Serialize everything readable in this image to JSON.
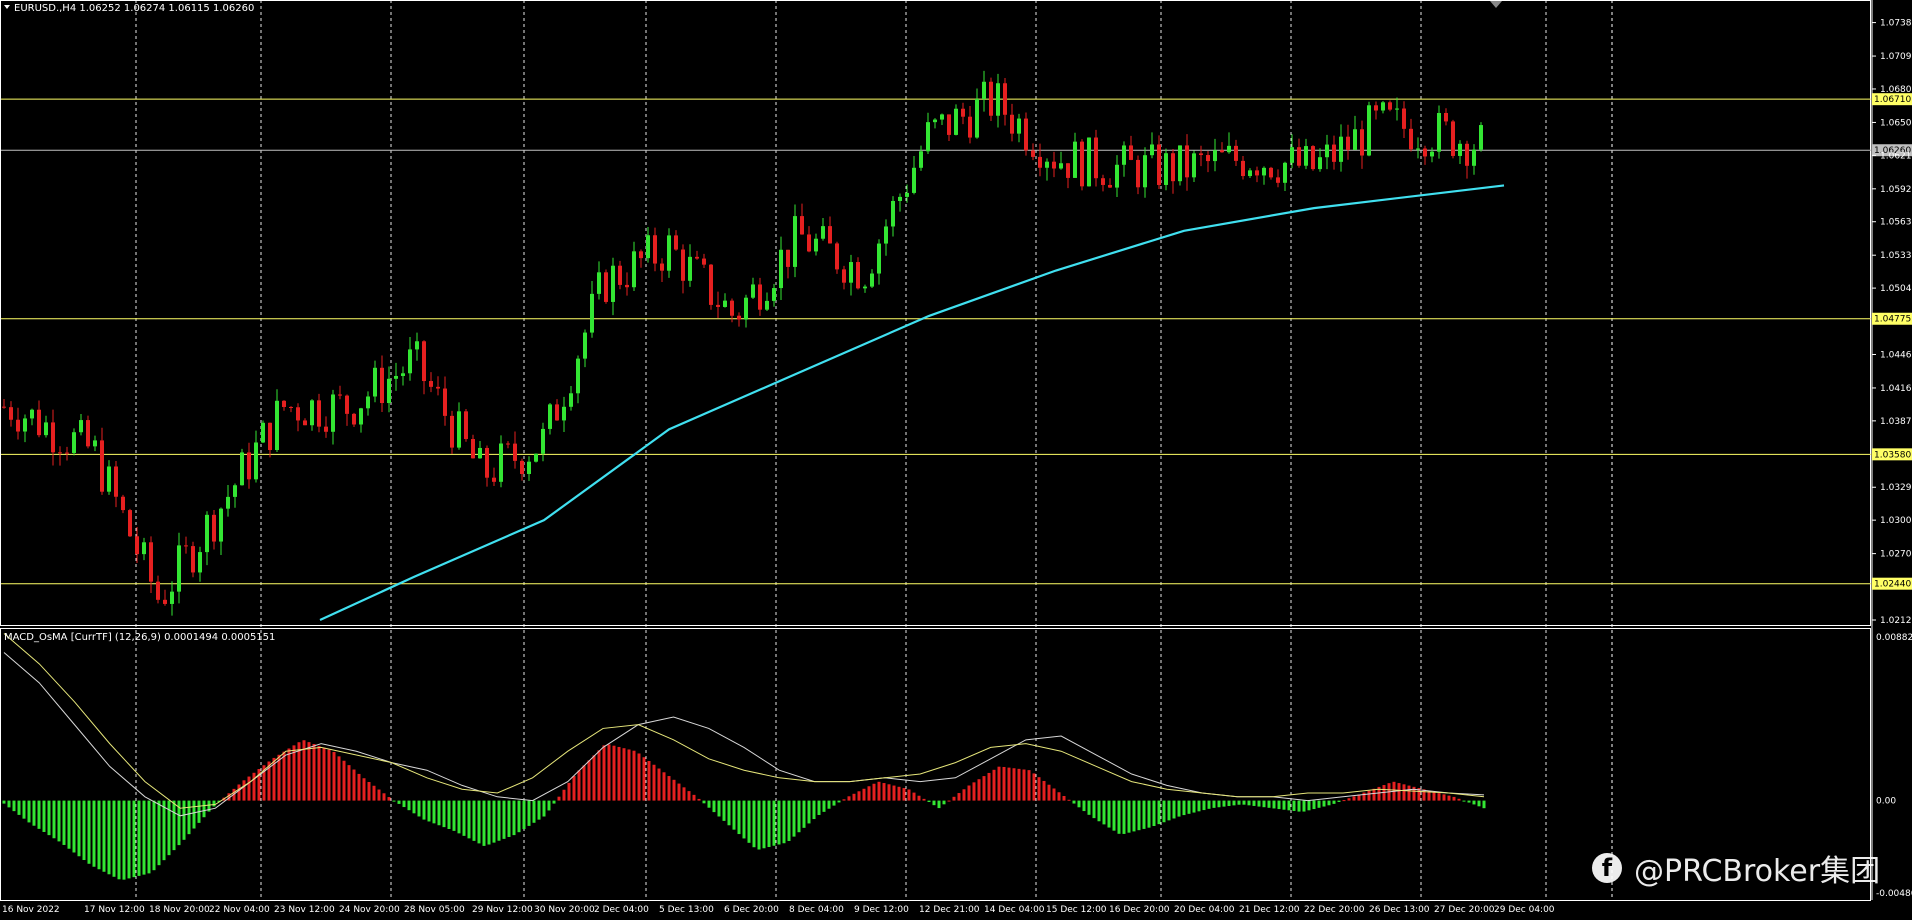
{
  "price_panel": {
    "header": "EURUSD.,H4  1.06252 1.06274 1.06115 1.06260",
    "price_axis_labels": [
      "1.07385",
      "1.07090",
      "1.06800",
      "1.06505",
      "1.06215",
      "1.05920",
      "1.05630",
      "1.05335",
      "1.05045",
      "1.04460",
      "1.04165",
      "1.03875",
      "1.03290",
      "1.03000",
      "1.02705",
      "1.02120"
    ],
    "horizontal_levels": [
      {
        "label": "1.06710",
        "color": "#ffff66"
      },
      {
        "label": "1.06260",
        "color": "#c0c0c0"
      },
      {
        "label": "1.04775",
        "color": "#ffff66"
      },
      {
        "label": "1.03580",
        "color": "#ffff66"
      },
      {
        "label": "1.02440",
        "color": "#ffff66"
      }
    ]
  },
  "indicator_panel": {
    "header": "MACD_OsMA [CurrTF] (12,26,9) 0.0001494 0.0005151",
    "axis_labels": [
      "0.008824",
      "0.00",
      "-0.004865"
    ]
  },
  "time_axis_labels": [
    "16 Nov 2022",
    "17 Nov 12:00",
    "18 Nov 20:00",
    "22 Nov 04:00",
    "23 Nov 12:00",
    "24 Nov 20:00",
    "28 Nov 05:00",
    "29 Nov 12:00",
    "30 Nov 20:00",
    "2 Dec 04:00",
    "5 Dec 13:00",
    "6 Dec 20:00",
    "8 Dec 04:00",
    "9 Dec 12:00",
    "12 Dec 21:00",
    "14 Dec 04:00",
    "15 Dec 12:00",
    "16 Dec 20:00",
    "20 Dec 04:00",
    "21 Dec 12:00",
    "22 Dec 20:00",
    "26 Dec 13:00",
    "27 Dec 20:00",
    "29 Dec 04:00"
  ],
  "watermark": {
    "icon": "facebook-icon",
    "text": "@PRCBroker集团"
  },
  "colors": {
    "bull": "#33e633",
    "bear": "#e62020",
    "ma": "#40e0f0",
    "level": "#ffff66",
    "grid": "#ffffff",
    "macd_signal": "#e6e67a",
    "macd_main": "#d8d8d8"
  },
  "chart_data": {
    "type": "candlestick",
    "symbol": "EURUSD.",
    "timeframe": "H4",
    "ohlc_last": {
      "open": 1.06252,
      "high": 1.06274,
      "low": 1.06115,
      "close": 1.0626
    },
    "ylim": [
      1.0212,
      1.0754
    ],
    "close_path": [
      {
        "date": "16 Nov 2022",
        "price": 1.04
      },
      {
        "date": "17 Nov 12:00",
        "price": 1.036
      },
      {
        "date": "18 Nov 20:00",
        "price": 1.023
      },
      {
        "date": "22 Nov 04:00",
        "price": 1.031
      },
      {
        "date": "23 Nov 12:00",
        "price": 1.04
      },
      {
        "date": "24 Nov 20:00",
        "price": 1.04
      },
      {
        "date": "28 Nov 05:00",
        "price": 1.044
      },
      {
        "date": "29 Nov 12:00",
        "price": 1.034
      },
      {
        "date": "30 Nov 20:00",
        "price": 1.037
      },
      {
        "date": "2 Dec 04:00",
        "price": 1.051
      },
      {
        "date": "5 Dec 13:00",
        "price": 1.054
      },
      {
        "date": "6 Dec 20:00",
        "price": 1.048
      },
      {
        "date": "8 Dec 04:00",
        "price": 1.055
      },
      {
        "date": "9 Dec 12:00",
        "price": 1.052
      },
      {
        "date": "12 Dec 21:00",
        "price": 1.064
      },
      {
        "date": "14 Dec 04:00",
        "price": 1.067
      },
      {
        "date": "15 Dec 12:00",
        "price": 1.062
      },
      {
        "date": "16 Dec 20:00",
        "price": 1.061
      },
      {
        "date": "20 Dec 04:00",
        "price": 1.061
      },
      {
        "date": "21 Dec 12:00",
        "price": 1.062
      },
      {
        "date": "22 Dec 20:00",
        "price": 1.061
      },
      {
        "date": "26 Dec 13:00",
        "price": 1.065
      },
      {
        "date": "27 Dec 20:00",
        "price": 1.064
      },
      {
        "date": "29 Dec 04:00",
        "price": 1.0626
      }
    ],
    "moving_average": [
      {
        "date": "24 Nov 20:00",
        "price": 1.0212
      },
      {
        "date": "28 Nov 05:00",
        "price": 1.025
      },
      {
        "date": "30 Nov 20:00",
        "price": 1.03
      },
      {
        "date": "5 Dec 13:00",
        "price": 1.038
      },
      {
        "date": "8 Dec 04:00",
        "price": 1.043
      },
      {
        "date": "12 Dec 21:00",
        "price": 1.048
      },
      {
        "date": "15 Dec 12:00",
        "price": 1.052
      },
      {
        "date": "20 Dec 04:00",
        "price": 1.0555
      },
      {
        "date": "22 Dec 20:00",
        "price": 1.0575
      },
      {
        "date": "29 Dec 04:00",
        "price": 1.0595
      }
    ],
    "macd_osma": {
      "ylim": [
        -0.004865,
        0.008824
      ],
      "histogram": [
        0,
        -0.0012,
        -0.0022,
        -0.0034,
        -0.0042,
        -0.0038,
        -0.0022,
        -0.0004,
        0.001,
        0.0022,
        0.0032,
        0.0026,
        0.0012,
        0.0,
        -0.001,
        -0.0016,
        -0.0024,
        -0.0018,
        -0.0008,
        0.0014,
        0.003,
        0.0026,
        0.0014,
        0.0002,
        -0.0012,
        -0.0026,
        -0.0022,
        -0.0008,
        0.0002,
        0.001,
        0.0006,
        -0.0004,
        0.0008,
        0.0018,
        0.0016,
        0.0004,
        -0.0008,
        -0.0018,
        -0.0014,
        -0.0008,
        -0.0004,
        -0.0002,
        -0.0004,
        -0.0006,
        -0.0002,
        0.0004,
        0.001,
        0.0006,
        0.0002,
        -0.0004
      ],
      "main": [
        0.0078,
        0.0062,
        0.004,
        0.0018,
        0.0002,
        -0.0008,
        -0.0004,
        0.001,
        0.0024,
        0.003,
        0.0026,
        0.002,
        0.0016,
        0.0008,
        0.0002,
        0.0,
        0.001,
        0.0028,
        0.004,
        0.0044,
        0.0038,
        0.0028,
        0.0016,
        0.001,
        0.001,
        0.0012,
        0.001,
        0.0012,
        0.0022,
        0.0032,
        0.0034,
        0.0024,
        0.0014,
        0.0008,
        0.0004,
        0.0002,
        0.0002,
        0.0,
        0.0002,
        0.0004,
        0.0006,
        0.0004,
        0.0003
      ],
      "signal": [
        0.0088,
        0.0072,
        0.0052,
        0.003,
        0.001,
        -0.0004,
        -0.0002,
        0.001,
        0.0026,
        0.0028,
        0.0024,
        0.002,
        0.0012,
        0.0006,
        0.0004,
        0.0012,
        0.0026,
        0.0038,
        0.004,
        0.0032,
        0.0022,
        0.0016,
        0.0012,
        0.001,
        0.001,
        0.0012,
        0.0014,
        0.002,
        0.0028,
        0.003,
        0.0026,
        0.0018,
        0.001,
        0.0006,
        0.0004,
        0.0002,
        0.0002,
        0.0004,
        0.0004,
        0.0006,
        0.0005,
        0.0004,
        0.0002
      ]
    }
  }
}
